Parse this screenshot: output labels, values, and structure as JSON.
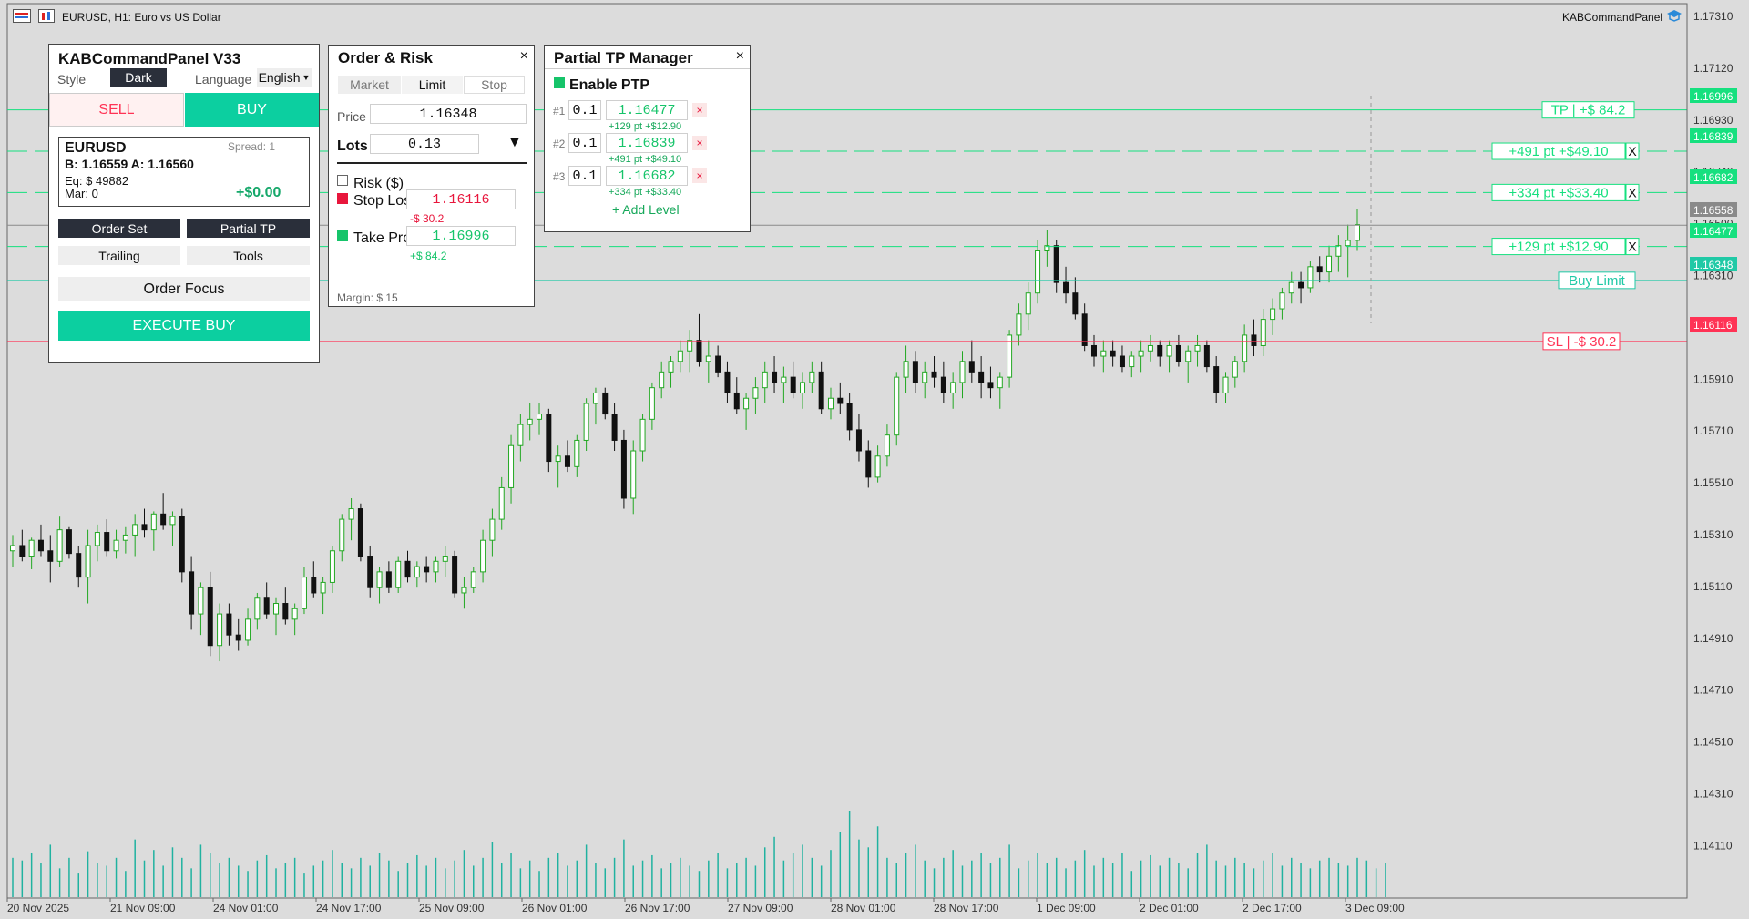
{
  "header": {
    "symbol_title": "EURUSD, H1:  Euro vs US Dollar",
    "indicator_name": "KABCommandPanel"
  },
  "colors": {
    "bull": "#22a822",
    "bear": "#111111",
    "accent": "#0ccfa0",
    "tp": "#16e07f",
    "sl": "#ff3355",
    "buy_limit": "#20c9a6",
    "current": "#8a8a8a"
  },
  "icons": [
    "menu-grid-icon",
    "chart-window-icon",
    "graduation-cap-icon"
  ],
  "price_axis": {
    "ticks": [
      "1.17310",
      "1.17120",
      "1.16930",
      "1.16740",
      "1.16500",
      "1.16310",
      "1.16120",
      "1.15910",
      "1.15710",
      "1.15510",
      "1.15310",
      "1.15110",
      "1.14910",
      "1.14710",
      "1.14510",
      "1.14310",
      "1.14110"
    ],
    "tags": [
      {
        "label": "1.16996",
        "kind": "tp"
      },
      {
        "label": "1.16839",
        "kind": "tp"
      },
      {
        "label": "1.16682",
        "kind": "tp"
      },
      {
        "label": "1.16558",
        "kind": "current"
      },
      {
        "label": "1.16477",
        "kind": "tp"
      },
      {
        "label": "1.16348",
        "kind": "buy_limit"
      },
      {
        "label": "1.16116",
        "kind": "sl"
      }
    ]
  },
  "time_axis": [
    "20 Nov 2025",
    "21 Nov 09:00",
    "24 Nov 01:00",
    "24 Nov 17:00",
    "25 Nov 09:00",
    "26 Nov 01:00",
    "26 Nov 17:00",
    "27 Nov 09:00",
    "28 Nov 01:00",
    "28 Nov 17:00",
    "1 Dec 09:00",
    "2 Dec 01:00",
    "2 Dec 17:00",
    "3 Dec 09:00"
  ],
  "chart_lines": [
    {
      "price": 1.16996,
      "kind": "tp",
      "label": "TP | +$ 84.2",
      "close": ""
    },
    {
      "price": 1.16839,
      "kind": "tp",
      "label": "+491 pt   +$49.10",
      "close": "X"
    },
    {
      "price": 1.16682,
      "kind": "tp",
      "label": "+334 pt   +$33.40",
      "close": "X"
    },
    {
      "price": 1.16558,
      "kind": "current",
      "label": "",
      "close": ""
    },
    {
      "price": 1.16477,
      "kind": "tp",
      "label": "+129 pt   +$12.90",
      "close": "X"
    },
    {
      "price": 1.16348,
      "kind": "buy_limit",
      "label": "Buy Limit",
      "close": ""
    },
    {
      "price": 1.16116,
      "kind": "sl",
      "label": "SL | -$ 30.2",
      "close": ""
    }
  ],
  "chart_data": {
    "type": "candlestick",
    "ylim": [
      1.14,
      1.174
    ],
    "candles": [
      [
        1.1532,
        1.1538,
        1.1526,
        1.1534
      ],
      [
        1.1534,
        1.154,
        1.1528,
        1.153
      ],
      [
        1.153,
        1.1537,
        1.1525,
        1.1536
      ],
      [
        1.1536,
        1.1542,
        1.153,
        1.1532
      ],
      [
        1.1532,
        1.1538,
        1.152,
        1.1528
      ],
      [
        1.1528,
        1.1545,
        1.1526,
        1.154
      ],
      [
        1.154,
        1.1541,
        1.1529,
        1.1531
      ],
      [
        1.1531,
        1.1534,
        1.1518,
        1.1522
      ],
      [
        1.1522,
        1.154,
        1.1512,
        1.1534
      ],
      [
        1.1534,
        1.1542,
        1.1528,
        1.1539
      ],
      [
        1.1539,
        1.1544,
        1.153,
        1.1532
      ],
      [
        1.1532,
        1.154,
        1.1529,
        1.1536
      ],
      [
        1.1536,
        1.1541,
        1.1531,
        1.1538
      ],
      [
        1.1538,
        1.1546,
        1.153,
        1.1542
      ],
      [
        1.1542,
        1.1548,
        1.1537,
        1.154
      ],
      [
        1.154,
        1.1547,
        1.1532,
        1.1546
      ],
      [
        1.1546,
        1.1554,
        1.154,
        1.1542
      ],
      [
        1.1542,
        1.1547,
        1.1534,
        1.1545
      ],
      [
        1.1545,
        1.1548,
        1.152,
        1.1524
      ],
      [
        1.1524,
        1.153,
        1.1502,
        1.1508
      ],
      [
        1.1508,
        1.152,
        1.15,
        1.1518
      ],
      [
        1.1518,
        1.1524,
        1.1492,
        1.1496
      ],
      [
        1.1496,
        1.1512,
        1.149,
        1.1508
      ],
      [
        1.1508,
        1.1512,
        1.1496,
        1.15
      ],
      [
        1.15,
        1.1506,
        1.1494,
        1.1498
      ],
      [
        1.1498,
        1.151,
        1.1496,
        1.1506
      ],
      [
        1.1506,
        1.1516,
        1.1502,
        1.1514
      ],
      [
        1.1514,
        1.152,
        1.1506,
        1.1508
      ],
      [
        1.1508,
        1.1514,
        1.15,
        1.1512
      ],
      [
        1.1512,
        1.1518,
        1.1504,
        1.1506
      ],
      [
        1.1506,
        1.1512,
        1.15,
        1.151
      ],
      [
        1.151,
        1.1526,
        1.1508,
        1.1522
      ],
      [
        1.1522,
        1.1528,
        1.1514,
        1.1516
      ],
      [
        1.1516,
        1.1522,
        1.1508,
        1.152
      ],
      [
        1.152,
        1.1534,
        1.1516,
        1.1532
      ],
      [
        1.1532,
        1.1546,
        1.1528,
        1.1544
      ],
      [
        1.1544,
        1.1552,
        1.1536,
        1.1548
      ],
      [
        1.1548,
        1.155,
        1.1528,
        1.153
      ],
      [
        1.153,
        1.1534,
        1.1514,
        1.1518
      ],
      [
        1.1518,
        1.1526,
        1.1512,
        1.1524
      ],
      [
        1.1524,
        1.1528,
        1.1516,
        1.1518
      ],
      [
        1.1518,
        1.153,
        1.1516,
        1.1528
      ],
      [
        1.1528,
        1.1532,
        1.152,
        1.1522
      ],
      [
        1.1522,
        1.1528,
        1.1518,
        1.1526
      ],
      [
        1.1526,
        1.153,
        1.152,
        1.1524
      ],
      [
        1.1524,
        1.153,
        1.152,
        1.1528
      ],
      [
        1.1528,
        1.1534,
        1.1522,
        1.153
      ],
      [
        1.153,
        1.1532,
        1.1514,
        1.1516
      ],
      [
        1.1516,
        1.1522,
        1.151,
        1.1518
      ],
      [
        1.1518,
        1.1526,
        1.1516,
        1.1524
      ],
      [
        1.1524,
        1.154,
        1.152,
        1.1536
      ],
      [
        1.1536,
        1.1548,
        1.153,
        1.1544
      ],
      [
        1.1544,
        1.156,
        1.154,
        1.1556
      ],
      [
        1.1556,
        1.1576,
        1.155,
        1.1572
      ],
      [
        1.1572,
        1.1584,
        1.1566,
        1.158
      ],
      [
        1.158,
        1.1588,
        1.1574,
        1.1582
      ],
      [
        1.1582,
        1.1588,
        1.1576,
        1.1584
      ],
      [
        1.1584,
        1.1586,
        1.1562,
        1.1566
      ],
      [
        1.1566,
        1.1572,
        1.1556,
        1.1568
      ],
      [
        1.1568,
        1.1574,
        1.1562,
        1.1564
      ],
      [
        1.1564,
        1.1576,
        1.156,
        1.1574
      ],
      [
        1.1574,
        1.159,
        1.157,
        1.1588
      ],
      [
        1.1588,
        1.1594,
        1.158,
        1.1592
      ],
      [
        1.1592,
        1.1594,
        1.1582,
        1.1584
      ],
      [
        1.1584,
        1.1588,
        1.157,
        1.1574
      ],
      [
        1.1574,
        1.1578,
        1.1548,
        1.1552
      ],
      [
        1.1552,
        1.1574,
        1.1546,
        1.157
      ],
      [
        1.157,
        1.1584,
        1.1566,
        1.1582
      ],
      [
        1.1582,
        1.1596,
        1.1578,
        1.1594
      ],
      [
        1.1594,
        1.1604,
        1.159,
        1.16
      ],
      [
        1.16,
        1.1606,
        1.1594,
        1.1604
      ],
      [
        1.1604,
        1.1612,
        1.16,
        1.1608
      ],
      [
        1.1608,
        1.1616,
        1.16,
        1.1612
      ],
      [
        1.1612,
        1.1622,
        1.1602,
        1.1604
      ],
      [
        1.1604,
        1.1612,
        1.1596,
        1.1606
      ],
      [
        1.1606,
        1.161,
        1.1598,
        1.16
      ],
      [
        1.16,
        1.1604,
        1.1588,
        1.1592
      ],
      [
        1.1592,
        1.1598,
        1.1584,
        1.1586
      ],
      [
        1.1586,
        1.1592,
        1.1578,
        1.159
      ],
      [
        1.159,
        1.1598,
        1.1584,
        1.1594
      ],
      [
        1.1594,
        1.1604,
        1.1588,
        1.16
      ],
      [
        1.16,
        1.1606,
        1.1592,
        1.1596
      ],
      [
        1.1596,
        1.1602,
        1.1588,
        1.1598
      ],
      [
        1.1598,
        1.1604,
        1.159,
        1.1592
      ],
      [
        1.1592,
        1.16,
        1.1586,
        1.1596
      ],
      [
        1.1596,
        1.1604,
        1.1592,
        1.16
      ],
      [
        1.16,
        1.1604,
        1.1584,
        1.1586
      ],
      [
        1.1586,
        1.1594,
        1.1582,
        1.159
      ],
      [
        1.159,
        1.1596,
        1.1584,
        1.1588
      ],
      [
        1.1588,
        1.1592,
        1.1574,
        1.1578
      ],
      [
        1.1578,
        1.1584,
        1.1566,
        1.157
      ],
      [
        1.157,
        1.1574,
        1.1556,
        1.156
      ],
      [
        1.156,
        1.1572,
        1.1558,
        1.1568
      ],
      [
        1.1568,
        1.158,
        1.1564,
        1.1576
      ],
      [
        1.1576,
        1.16,
        1.1572,
        1.1598
      ],
      [
        1.1598,
        1.161,
        1.1592,
        1.1604
      ],
      [
        1.1604,
        1.1608,
        1.1592,
        1.1596
      ],
      [
        1.1596,
        1.1604,
        1.159,
        1.16
      ],
      [
        1.16,
        1.1606,
        1.1594,
        1.1598
      ],
      [
        1.1598,
        1.1604,
        1.1588,
        1.1592
      ],
      [
        1.1592,
        1.16,
        1.1586,
        1.1596
      ],
      [
        1.1596,
        1.1608,
        1.159,
        1.1604
      ],
      [
        1.1604,
        1.1612,
        1.1596,
        1.16
      ],
      [
        1.16,
        1.1606,
        1.159,
        1.1596
      ],
      [
        1.1596,
        1.1602,
        1.159,
        1.1594
      ],
      [
        1.1594,
        1.16,
        1.1586,
        1.1598
      ],
      [
        1.1598,
        1.1616,
        1.1594,
        1.1614
      ],
      [
        1.1614,
        1.1626,
        1.161,
        1.1622
      ],
      [
        1.1622,
        1.1634,
        1.1616,
        1.163
      ],
      [
        1.163,
        1.165,
        1.1626,
        1.1646
      ],
      [
        1.1646,
        1.1654,
        1.164,
        1.1648
      ],
      [
        1.1648,
        1.165,
        1.163,
        1.1634
      ],
      [
        1.1634,
        1.164,
        1.1626,
        1.163
      ],
      [
        1.163,
        1.1636,
        1.162,
        1.1622
      ],
      [
        1.1622,
        1.1626,
        1.1608,
        1.161
      ],
      [
        1.161,
        1.1614,
        1.1602,
        1.1606
      ],
      [
        1.1606,
        1.1612,
        1.16,
        1.1608
      ],
      [
        1.1608,
        1.1612,
        1.1602,
        1.1606
      ],
      [
        1.1606,
        1.161,
        1.16,
        1.1602
      ],
      [
        1.1602,
        1.1608,
        1.1598,
        1.1606
      ],
      [
        1.1606,
        1.1612,
        1.16,
        1.1608
      ],
      [
        1.1608,
        1.1614,
        1.1604,
        1.161
      ],
      [
        1.161,
        1.1612,
        1.1602,
        1.1606
      ],
      [
        1.1606,
        1.1612,
        1.16,
        1.161
      ],
      [
        1.161,
        1.1614,
        1.1602,
        1.1604
      ],
      [
        1.1604,
        1.161,
        1.1596,
        1.1608
      ],
      [
        1.1608,
        1.1614,
        1.1602,
        1.161
      ],
      [
        1.161,
        1.1612,
        1.16,
        1.1602
      ],
      [
        1.1602,
        1.1606,
        1.1588,
        1.1592
      ],
      [
        1.1592,
        1.16,
        1.1588,
        1.1598
      ],
      [
        1.1598,
        1.1606,
        1.1594,
        1.1604
      ],
      [
        1.1604,
        1.1618,
        1.16,
        1.1614
      ],
      [
        1.1614,
        1.162,
        1.1606,
        1.161
      ],
      [
        1.161,
        1.1624,
        1.1606,
        1.162
      ],
      [
        1.162,
        1.1628,
        1.1614,
        1.1624
      ],
      [
        1.1624,
        1.1632,
        1.162,
        1.163
      ],
      [
        1.163,
        1.1638,
        1.1626,
        1.1634
      ],
      [
        1.1634,
        1.1638,
        1.1626,
        1.1632
      ],
      [
        1.1632,
        1.1642,
        1.163,
        1.164
      ],
      [
        1.164,
        1.1644,
        1.1634,
        1.1638
      ],
      [
        1.1638,
        1.1648,
        1.1634,
        1.1644
      ],
      [
        1.1644,
        1.1652,
        1.1638,
        1.1648
      ],
      [
        1.1648,
        1.1656,
        1.1636,
        1.165
      ],
      [
        1.165,
        1.1662,
        1.1646,
        1.1656
      ]
    ],
    "volume": [
      30,
      28,
      34,
      26,
      40,
      22,
      30,
      18,
      35,
      26,
      24,
      30,
      20,
      44,
      28,
      36,
      24,
      38,
      30,
      22,
      40,
      34,
      26,
      30,
      24,
      20,
      28,
      32,
      22,
      26,
      30,
      18,
      24,
      28,
      36,
      26,
      22,
      30,
      24,
      34,
      28,
      20,
      26,
      32,
      24,
      30,
      22,
      28,
      36,
      24,
      30,
      42,
      26,
      34,
      22,
      28,
      20,
      30,
      34,
      24,
      28,
      40,
      26,
      22,
      30,
      44,
      24,
      28,
      32,
      22,
      26,
      30,
      24,
      20,
      28,
      34,
      22,
      26,
      30,
      24,
      38,
      46,
      28,
      34,
      40,
      30,
      24,
      36,
      50,
      66,
      44,
      38,
      54,
      30,
      26,
      34,
      40,
      28,
      22,
      30,
      36,
      24,
      28,
      34,
      26,
      30,
      40,
      22,
      28,
      34,
      26,
      30,
      22,
      28,
      36,
      24,
      30,
      26,
      34,
      20,
      28,
      32,
      24,
      30,
      26,
      22,
      34,
      40,
      28,
      24,
      30,
      26,
      22,
      28,
      34,
      24,
      30,
      26,
      22,
      28,
      30,
      26,
      24,
      30,
      28,
      22,
      26
    ]
  },
  "kab_panel": {
    "title": "KABCommandPanel  V33",
    "style_label": "Style",
    "style_value": "Dark",
    "language_label": "Language",
    "language_value": "English",
    "sell_label": "SELL",
    "buy_label": "BUY",
    "symbol": "EURUSD",
    "spread": "Spread: 1",
    "bid_ask": "B: 1.16559  A: 1.16560",
    "equity": "Eq: $ 49882",
    "margin": "Mar: 0",
    "pnl": "+$0.00",
    "tabs": [
      "Order Set",
      "Partial TP",
      "Trailing",
      "Tools"
    ],
    "order_focus": "Order Focus",
    "execute": "EXECUTE BUY"
  },
  "order_risk": {
    "title": "Order & Risk",
    "close": "×",
    "modes": [
      "Market",
      "Limit",
      "Stop"
    ],
    "price_label": "Price",
    "price_value": "1.16348",
    "lots_label": "Lots",
    "lots_value": "0.13",
    "risk_label": "Risk ($)",
    "sl_label": "Stop Los",
    "sl_value": "1.16116",
    "sl_hint": "-$ 30.2",
    "tp_label": "Take Pro",
    "tp_value": "1.16996",
    "tp_hint": "+$ 84.2",
    "margin": "Margin: $ 15"
  },
  "ptp": {
    "title": "Partial TP Manager",
    "close": "×",
    "enable": "Enable PTP",
    "levels": [
      {
        "idx": "#1",
        "lot": "0.1",
        "price": "1.16477",
        "info": "+129 pt   +$12.90"
      },
      {
        "idx": "#2",
        "lot": "0.1",
        "price": "1.16839",
        "info": "+491 pt   +$49.10"
      },
      {
        "idx": "#3",
        "lot": "0.1",
        "price": "1.16682",
        "info": "+334 pt   +$33.40"
      }
    ],
    "remove": "×",
    "add": "+ Add Level"
  }
}
